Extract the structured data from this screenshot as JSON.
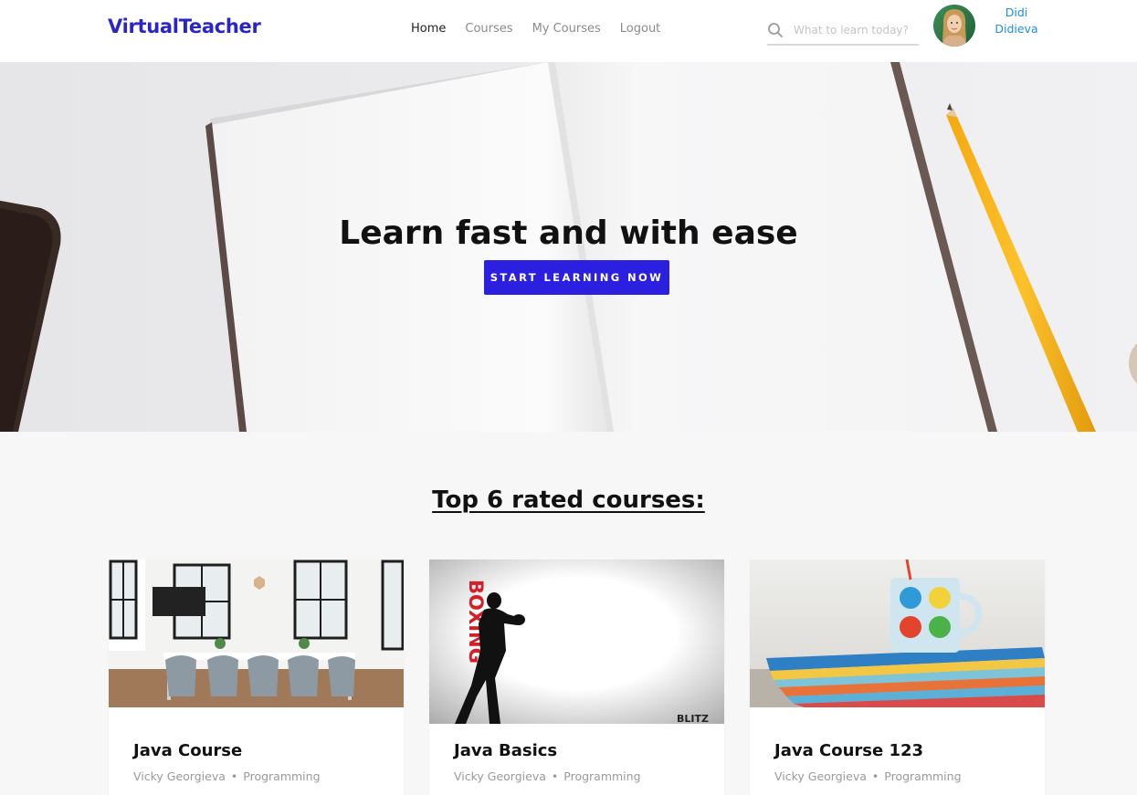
{
  "brand": {
    "name": "VirtualTeacher",
    "color": "#2b24c8"
  },
  "nav": [
    {
      "label": "Home",
      "active": true
    },
    {
      "label": "Courses",
      "active": false
    },
    {
      "label": "My Courses",
      "active": false
    },
    {
      "label": "Logout",
      "active": false
    }
  ],
  "search": {
    "placeholder": "What to learn today?",
    "icon": "search-icon"
  },
  "user": {
    "first_name": "Didi",
    "last_name": "Didieva",
    "avatar": "user-avatar-photo"
  },
  "hero": {
    "title": "Learn fast and with ease",
    "cta_label": "START LEARNING NOW",
    "cta_color": "#2b1fe0",
    "image": "notebook-and-pencil-photo"
  },
  "courses_section": {
    "title": "Top 6 rated courses:",
    "courses": [
      {
        "title": "Java Course",
        "teacher": "Vicky Georgieva",
        "category": "Programming",
        "image": "meeting-room-photo"
      },
      {
        "title": "Java Basics",
        "teacher": "Vicky Georgieva",
        "category": "Programming",
        "image": "boxing-poster-photo"
      },
      {
        "title": "Java Course 123",
        "teacher": "Vicky Georgieva",
        "category": "Programming",
        "image": "books-and-mug-photo"
      }
    ]
  },
  "boxing_poster": {
    "word": "BOXING",
    "brand": "BLITZ"
  }
}
